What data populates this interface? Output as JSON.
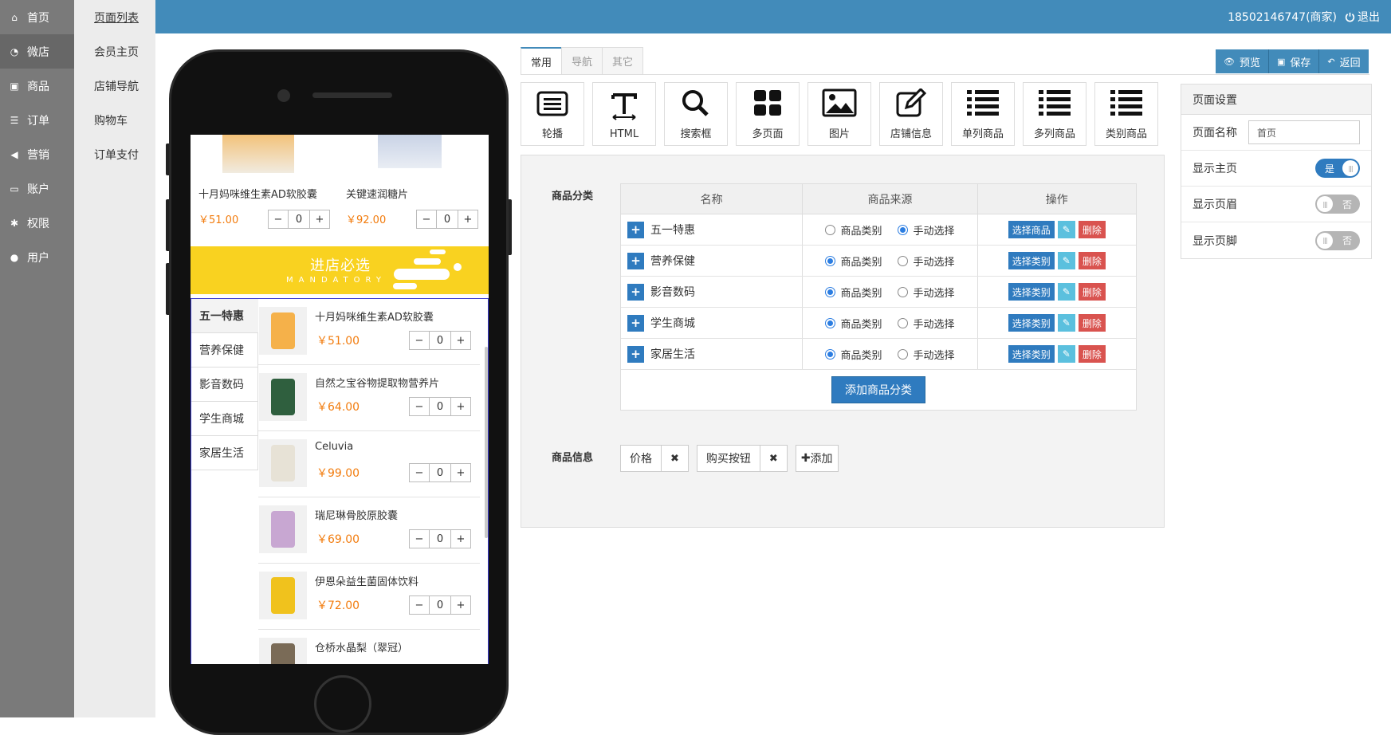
{
  "sidebar": {
    "items": [
      {
        "label": "首页",
        "icon": "home-icon"
      },
      {
        "label": "微店",
        "icon": "dashboard-icon"
      },
      {
        "label": "商品",
        "icon": "gift-icon"
      },
      {
        "label": "订单",
        "icon": "list-icon"
      },
      {
        "label": "营销",
        "icon": "bullhorn-icon"
      },
      {
        "label": "账户",
        "icon": "money-icon"
      },
      {
        "label": "权限",
        "icon": "gear-icon"
      },
      {
        "label": "用户",
        "icon": "user-icon"
      }
    ],
    "active_index": 1
  },
  "subnav": {
    "items": [
      "页面列表",
      "会员主页",
      "店铺导航",
      "购物车",
      "订单支付"
    ],
    "active_index": 0
  },
  "topbar": {
    "user": "18502146747(商家)",
    "logout": "退出"
  },
  "phone": {
    "top_products": [
      {
        "name": "十月妈咪维生素AD软胶囊",
        "price": "￥51.00",
        "qty": "0"
      },
      {
        "name": "关键速润糖片",
        "price": "￥92.00",
        "qty": "0"
      }
    ],
    "banner": {
      "title": "进店必选",
      "subtitle": "MANDATORY"
    },
    "categories": [
      "五一特惠",
      "营养保健",
      "影音数码",
      "学生商城",
      "家居生活"
    ],
    "goods": [
      {
        "name": "十月妈咪维生素AD软胶囊",
        "price": "￥51.00",
        "qty": "0"
      },
      {
        "name": "自然之宝谷物提取物营养片",
        "price": "￥64.00",
        "qty": "0"
      },
      {
        "name": "Celuvia",
        "price": "￥99.00",
        "qty": "0"
      },
      {
        "name": "瑞尼琳骨胶原胶囊",
        "price": "￥69.00",
        "qty": "0"
      },
      {
        "name": "伊恩朵益生菌固体饮料",
        "price": "￥72.00",
        "qty": "0"
      },
      {
        "name": "仓桥水晶梨（翠冠）",
        "price": "",
        "qty": ""
      }
    ],
    "stepper": {
      "minus": "−",
      "plus": "+"
    }
  },
  "tabs": [
    "常用",
    "导航",
    "其它"
  ],
  "actions": {
    "preview": "预览",
    "save": "保存",
    "back": "返回"
  },
  "widgets": [
    "轮播",
    "HTML",
    "搜索框",
    "多页面",
    "图片",
    "店铺信息",
    "单列商品",
    "多列商品",
    "类别商品"
  ],
  "editor": {
    "category_label": "商品分类",
    "columns": [
      "名称",
      "商品来源",
      "操作"
    ],
    "source_options": [
      "商品类别",
      "手动选择"
    ],
    "rows": [
      {
        "name": "五一特惠",
        "source": 1,
        "select": "选择商品"
      },
      {
        "name": "营养保健",
        "source": 0,
        "select": "选择类别"
      },
      {
        "name": "影音数码",
        "source": 0,
        "select": "选择类别"
      },
      {
        "name": "学生商城",
        "source": 0,
        "select": "选择类别"
      },
      {
        "name": "家居生活",
        "source": 0,
        "select": "选择类别"
      }
    ],
    "delete_label": "删除",
    "add_category": "添加商品分类",
    "info_label": "商品信息",
    "info_chips": [
      "价格",
      "购买按钮"
    ],
    "add_label": "添加"
  },
  "settings": {
    "title": "页面设置",
    "name_label": "页面名称",
    "name_value": "首页",
    "toggles": [
      {
        "label": "显示主页",
        "state": "是",
        "on": true
      },
      {
        "label": "显示页眉",
        "state": "否",
        "on": false
      },
      {
        "label": "显示页脚",
        "state": "否",
        "on": false
      }
    ]
  }
}
